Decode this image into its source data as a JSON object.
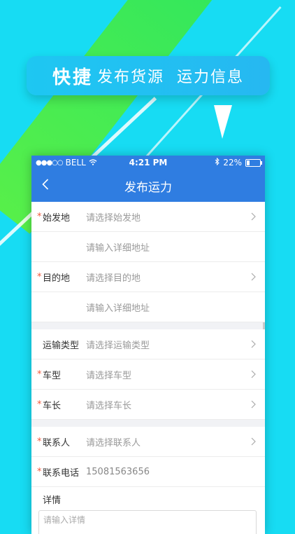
{
  "banner": {
    "part1": "快捷",
    "part2": "发布货源",
    "part3": "运力信息"
  },
  "status": {
    "carrier": "BELL",
    "time": "4:21 PM",
    "battery": "22%",
    "battery_level": 0.22
  },
  "nav": {
    "title": "发布运力"
  },
  "form": {
    "origin": {
      "label": "始发地",
      "value": "请选择始发地"
    },
    "origin_address": {
      "value": "请输入详细地址"
    },
    "destination": {
      "label": "目的地",
      "value": "请选择目的地"
    },
    "destination_address": {
      "value": "请输入详细地址"
    },
    "transport_type": {
      "label": "运输类型",
      "value": "请选择运输类型"
    },
    "vehicle_type": {
      "label": "车型",
      "value": "请选择车型"
    },
    "vehicle_length": {
      "label": "车长",
      "value": "请选择车长"
    },
    "contact": {
      "label": "联系人",
      "value": "请选择联系人"
    },
    "phone": {
      "label": "联系电话",
      "value": "15081563656"
    },
    "details": {
      "label": "详情",
      "placeholder": "请输入详情"
    }
  },
  "colors": {
    "primary": "#2f7de1",
    "accent": "#17dcf3",
    "required": "#f2573b"
  }
}
